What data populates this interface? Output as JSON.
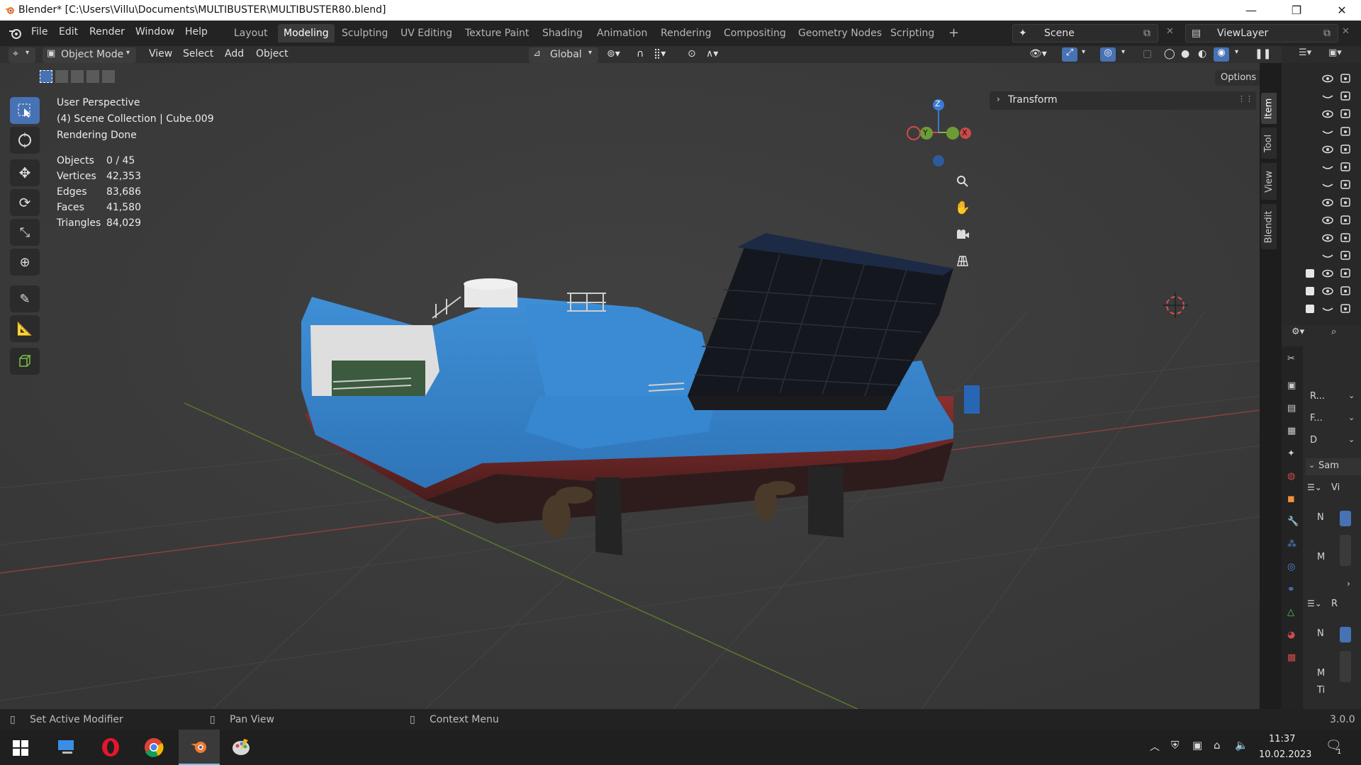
{
  "window": {
    "title": "Blender* [C:\\Users\\Villu\\Documents\\MULTIBUSTER\\MULTIBUSTER80.blend]",
    "minimize": "—",
    "maximize": "❐",
    "close": "✕"
  },
  "menu": [
    "File",
    "Edit",
    "Render",
    "Window",
    "Help"
  ],
  "workspaces": {
    "tabs": [
      "Layout",
      "Modeling",
      "Sculpting",
      "UV Editing",
      "Texture Paint",
      "Shading",
      "Animation",
      "Rendering",
      "Compositing",
      "Geometry Nodes",
      "Scripting"
    ],
    "active": "Modeling",
    "add": "+"
  },
  "scene": {
    "label": "Scene"
  },
  "view_layer": {
    "label": "ViewLayer"
  },
  "header": {
    "mode": "Object Mode",
    "items": [
      "View",
      "Select",
      "Add",
      "Object"
    ],
    "orientation": "Global",
    "options": "Options"
  },
  "overlay": {
    "perspective": "User Perspective",
    "collection": "(4) Scene Collection | Cube.009",
    "status": "Rendering Done",
    "stats": [
      {
        "label": "Objects",
        "value": "0 / 45"
      },
      {
        "label": "Vertices",
        "value": "42,353"
      },
      {
        "label": "Edges",
        "value": "83,686"
      },
      {
        "label": "Faces",
        "value": "41,580"
      },
      {
        "label": "Triangles",
        "value": "84,029"
      }
    ]
  },
  "gizmo": {
    "z": "Z",
    "y": "Y",
    "x": "X"
  },
  "npanel": {
    "transform": "Transform",
    "tabs": [
      "Item",
      "Tool",
      "View",
      "Blendit"
    ]
  },
  "properties": {
    "rows": [
      "R...",
      "F...",
      "D",
      "Sam",
      "Vi",
      "N",
      "M",
      "R",
      "N",
      "M",
      "Ti"
    ]
  },
  "statusbar": {
    "left": "Set Active Modifier",
    "middle": "Pan View",
    "right": "Context Menu",
    "version": "3.0.0"
  },
  "taskbar": {
    "time": "11:37",
    "date": "10.02.2023",
    "notification_count": "1"
  },
  "colors": {
    "accent": "#4772b3",
    "hull_blue": "#3b86cc",
    "hull_red": "#7a2a2a",
    "ramp": "#15181f"
  }
}
